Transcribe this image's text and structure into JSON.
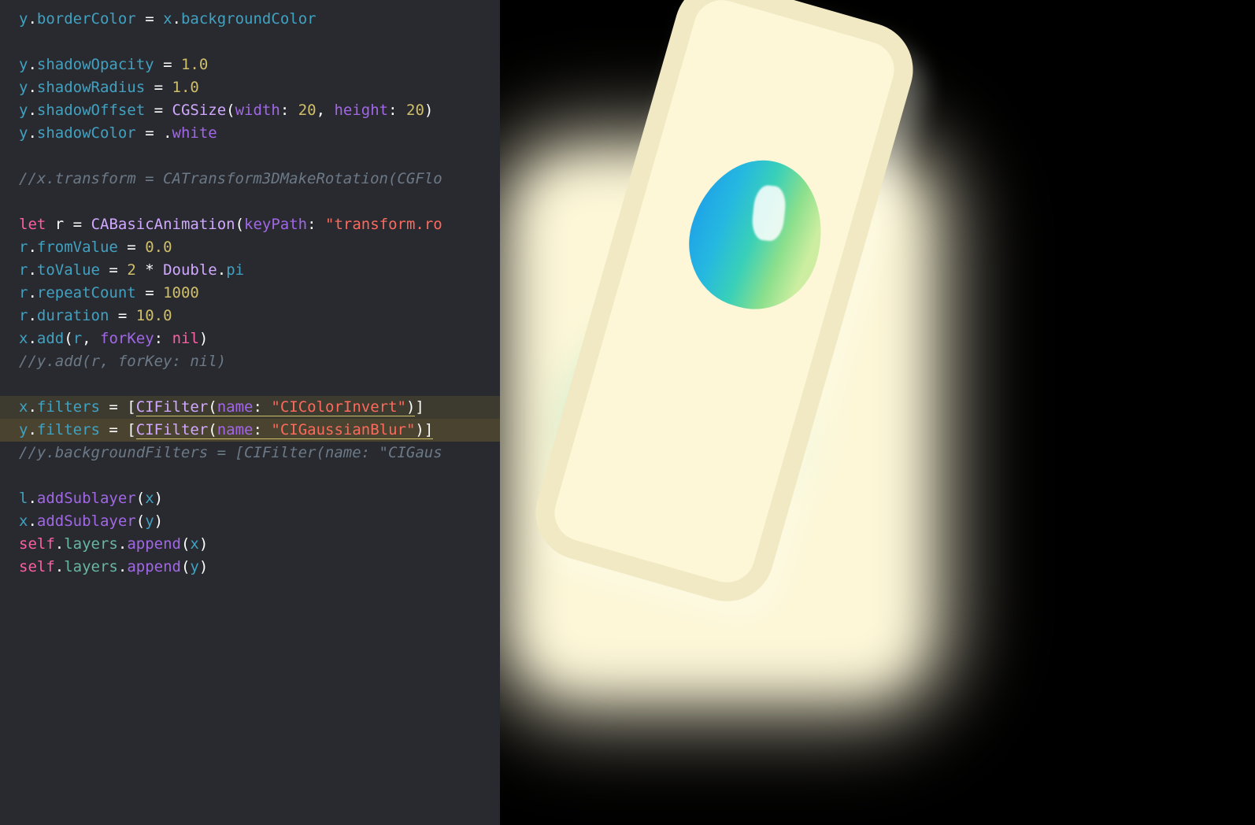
{
  "code": {
    "l1": {
      "a": "y",
      "b": "borderColor",
      "c": " = ",
      "d": "x",
      "e": "backgroundColor"
    },
    "l3a": {
      "a": "y",
      "b": "shadowOpacity",
      "c": " = ",
      "d": "1.0"
    },
    "l3b": {
      "a": "y",
      "b": "shadowRadius",
      "c": " = ",
      "d": "1.0"
    },
    "l4": {
      "a": "y",
      "b": "shadowOffset",
      "c": " = ",
      "d": "CGSize",
      "e": "(",
      "f": "width",
      "g": ": ",
      "h": "20",
      "i": ", ",
      "j": "height",
      "k": ": ",
      "l": "20",
      "m": ")"
    },
    "l5": {
      "a": "y",
      "b": "shadowColor",
      "c": " = .",
      "d": "white"
    },
    "l7": "//x.transform = CATransform3DMakeRotation(CGFlo",
    "l9": {
      "a": "let",
      "b": " ",
      "c": "r",
      "d": " = ",
      "e": "CABasicAnimation",
      "f": "(",
      "g": "keyPath",
      "h": ": ",
      "i": "\"transform.ro"
    },
    "l10": {
      "a": "r",
      "b": "fromValue",
      "c": " = ",
      "d": "0.0"
    },
    "l11": {
      "a": "r",
      "b": "toValue",
      "c": " = ",
      "d": "2",
      "e": " * ",
      "f": "Double",
      "g": "pi"
    },
    "l12": {
      "a": "r",
      "b": "repeatCount",
      "c": " = ",
      "d": "1000"
    },
    "l13": {
      "a": "r",
      "b": "duration",
      "c": " = ",
      "d": "10.0"
    },
    "l14": {
      "a": "x",
      "b": "add",
      "c": "(",
      "d": "r",
      "e": ", ",
      "f": "forKey",
      "g": ": ",
      "h": "nil",
      "i": ")"
    },
    "l15": "//y.add(r, forKey: nil)",
    "l17": {
      "a": "x",
      "b": "filters",
      "c": " = [",
      "d": "CIFilter",
      "e": "(",
      "f": "name",
      "g": ": ",
      "h": "\"CIColorInvert\"",
      "i": ")",
      "j": "]"
    },
    "l18": {
      "a": "y",
      "b": "filters",
      "c": " = [",
      "d": "CIFilter",
      "e": "(",
      "f": "name",
      "g": ": ",
      "h": "\"CIGaussianBlur\"",
      "i": ")",
      "j": "]"
    },
    "l19": "//y.backgroundFilters = [CIFilter(name: \"CIGaus",
    "l21": {
      "a": "l",
      "b": "addSublayer",
      "c": "(",
      "d": "x",
      "e": ")"
    },
    "l22": {
      "a": "x",
      "b": "addSublayer",
      "c": "(",
      "d": "y",
      "e": ")"
    },
    "l23": {
      "a": "self",
      "b": "layers",
      "c": "append",
      "d": "(",
      "e": "x",
      "f": ")"
    },
    "l24": {
      "a": "self",
      "b": "layers",
      "c": "append",
      "d": "(",
      "e": "y",
      "f": ")"
    }
  },
  "colors": {
    "editor_bg": "#292a30",
    "preview_bg": "#000000",
    "card_fill": "#fdf7d8",
    "card_border": "#f0e9c3"
  }
}
